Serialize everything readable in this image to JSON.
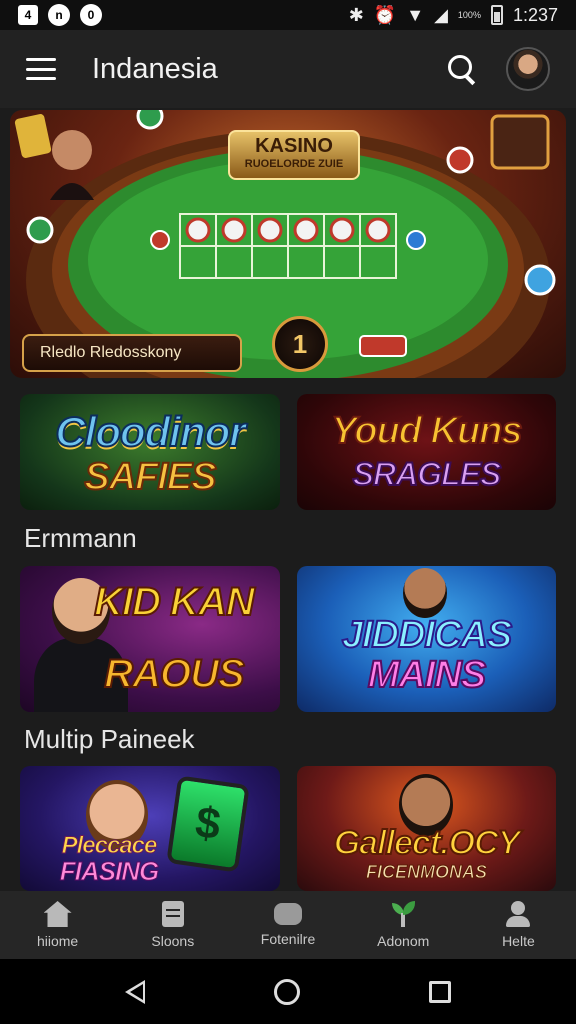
{
  "status_bar": {
    "left_icons": [
      "sim-icon",
      "notification-icon",
      "circle-app-icon"
    ],
    "left_glyphs": [
      "4",
      "n",
      "0"
    ],
    "battery_text": "100%",
    "time": "1:237"
  },
  "app_bar": {
    "title": "Indanesia",
    "menu_icon": "hamburger-menu-icon",
    "search_icon": "search-icon"
  },
  "hero": {
    "logo_line1": "KASINO",
    "logo_line2": "RUOELORDE ZUIE",
    "banner_text": "Rledlo Rledosskony",
    "badge": "1"
  },
  "sections": {
    "section2_title": "Ermmann",
    "section3_title": "Multip Paineek"
  },
  "tiles": [
    {
      "line1": "Cloodinor",
      "line2": "SAFIES"
    },
    {
      "line1": "Youd Kuns",
      "line2": "SRAGLES"
    },
    {
      "line1": "KID KAN",
      "line2": "RAOUS"
    },
    {
      "line1": "JIDDICAS",
      "line2": "MAINS"
    },
    {
      "line1": "Pleccace",
      "line2": "FIASING"
    },
    {
      "line1": "Gallect.OCY",
      "line2": "FICENMONAS"
    }
  ],
  "bottom_nav": [
    {
      "label": "hiiome",
      "icon": "home-icon"
    },
    {
      "label": "Sloons",
      "icon": "document-icon"
    },
    {
      "label": "Fotenilre",
      "icon": "gamepad-icon"
    },
    {
      "label": "Adonom",
      "icon": "plant-icon"
    },
    {
      "label": "Helte",
      "icon": "user-icon"
    }
  ],
  "colors": {
    "background": "#1c1c1c",
    "app_bar": "#222222",
    "nav_bar": "#262626",
    "accent_gold": "#d6a24a"
  }
}
